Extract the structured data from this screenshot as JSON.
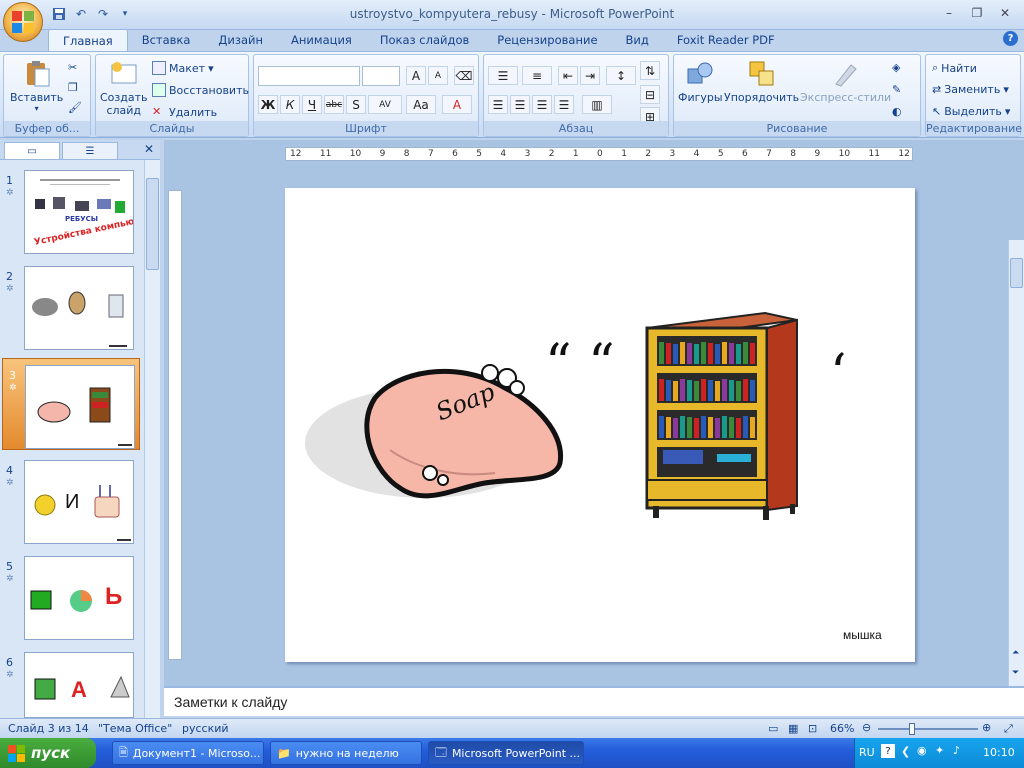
{
  "window": {
    "title": "ustroystvo_kompyutera_rebusy - Microsoft PowerPoint",
    "controls": [
      "–",
      "❐",
      "✕"
    ]
  },
  "ribbon_tabs": [
    "Главная",
    "Вставка",
    "Дизайн",
    "Анимация",
    "Показ слайдов",
    "Рецензирование",
    "Вид",
    "Foxit Reader PDF"
  ],
  "active_tab": "Главная",
  "groups": {
    "clipboard": {
      "title": "Буфер об...",
      "paste": "Вставить"
    },
    "slides": {
      "title": "Слайды",
      "new_slide_line1": "Создать",
      "new_slide_line2": "слайд",
      "layout": "Макет",
      "reset": "Восстановить",
      "delete": "Удалить"
    },
    "font": {
      "title": "Шрифт",
      "bold": "Ж",
      "italic": "К",
      "underline": "Ч",
      "strike": "abc",
      "shadow": "S",
      "spacing": "AV",
      "case": "Aa",
      "color": "A",
      "grow": "A",
      "shrink": "A"
    },
    "paragraph": {
      "title": "Абзац"
    },
    "drawing": {
      "title": "Рисование",
      "shapes": "Фигуры",
      "arrange": "Упорядочить",
      "quick_styles": "Экспресс-стили"
    },
    "editing": {
      "title": "Редактирование",
      "find": "Найти",
      "replace": "Заменить",
      "select": "Выделить"
    }
  },
  "ruler": {
    "labels": [
      "12",
      "11",
      "10",
      "9",
      "8",
      "7",
      "6",
      "5",
      "4",
      "3",
      "2",
      "1",
      "0",
      "1",
      "2",
      "3",
      "4",
      "5",
      "6",
      "7",
      "8",
      "9",
      "10",
      "11",
      "12"
    ]
  },
  "thumbnails": [
    {
      "num": "1",
      "title": "Устройства компьютера",
      "subtitle": "РЕБУСЫ"
    },
    {
      "num": "2"
    },
    {
      "num": "3",
      "selected": true
    },
    {
      "num": "4",
      "letter": "И"
    },
    {
      "num": "5",
      "letter": "Ь"
    },
    {
      "num": "6",
      "letter": "А"
    }
  ],
  "slide": {
    "soap_text": "Soap",
    "quote_marks": "“ “",
    "comma_mark": "‘",
    "caption": "мышка"
  },
  "notes_placeholder": "Заметки к слайду",
  "status": {
    "slide": "Слайд 3 из 14",
    "theme": "\"Тема Office\"",
    "language": "русский",
    "zoom": "66%"
  },
  "taskbar": {
    "start": "пуск",
    "items": [
      "Документ1 - Microso...",
      "нужно на неделю",
      "Microsoft PowerPoint ..."
    ],
    "lang": "RU",
    "time": "10:10"
  },
  "colors": {
    "accent": "#15428b",
    "selected_thumb": "#e48a2e",
    "taskbar": "#245edb"
  }
}
